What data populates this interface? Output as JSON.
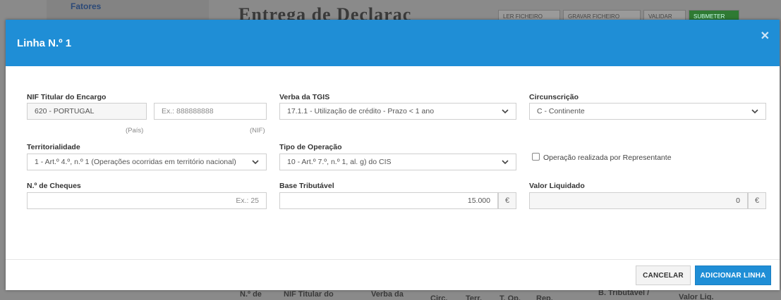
{
  "background": {
    "sidebar_link": "Fatores",
    "heading": "Entrega de Declaraç",
    "buttons": [
      "LER FICHEIRO",
      "GRAVAR FICHEIRO",
      "VALIDAR",
      "SUBMETER"
    ],
    "table_headers": [
      "N.º de",
      "NIF Titular do",
      "Verba da",
      "Circ.",
      "Terr.",
      "T. Op.",
      "Rep.",
      "B. Tributável /",
      "Valor Liq."
    ]
  },
  "modal": {
    "title": "Linha N.º 1",
    "close_icon": "close-icon",
    "fields": {
      "nif_titular": {
        "label": "NIF Titular do Encargo",
        "country_value": "620 - PORTUGAL",
        "country_sublabel": "(País)",
        "nif_placeholder": "Ex.: 888888888",
        "nif_sublabel": "(NIF)"
      },
      "verba": {
        "label": "Verba da TGIS",
        "value": "17.1.1 - Utilização de crédito - Prazo < 1 ano"
      },
      "circunscricao": {
        "label": "Circunscrição",
        "value": "C - Continente"
      },
      "territorialidade": {
        "label": "Territorialidade",
        "value": "1 - Art.º 4.º, n.º 1 (Operações ocorridas em território nacional)"
      },
      "tipo_operacao": {
        "label": "Tipo de Operação",
        "value": "10 - Art.º 7.º, n.º 1, al. g) do CIS"
      },
      "representante": {
        "label": "Operação realizada por Representante",
        "checked": false
      },
      "n_cheques": {
        "label": "N.º de Cheques",
        "placeholder": "Ex.: 25"
      },
      "base_tributavel": {
        "label": "Base Tributável",
        "value": "15.000",
        "currency": "€"
      },
      "valor_liquidado": {
        "label": "Valor Liquidado",
        "value": "0",
        "currency": "€"
      }
    },
    "footer": {
      "cancel_label": "CANCELAR",
      "add_label": "ADICIONAR LINHA"
    }
  },
  "colors": {
    "header": "#1f8ed6",
    "primary_button": "#1f8ed6"
  }
}
